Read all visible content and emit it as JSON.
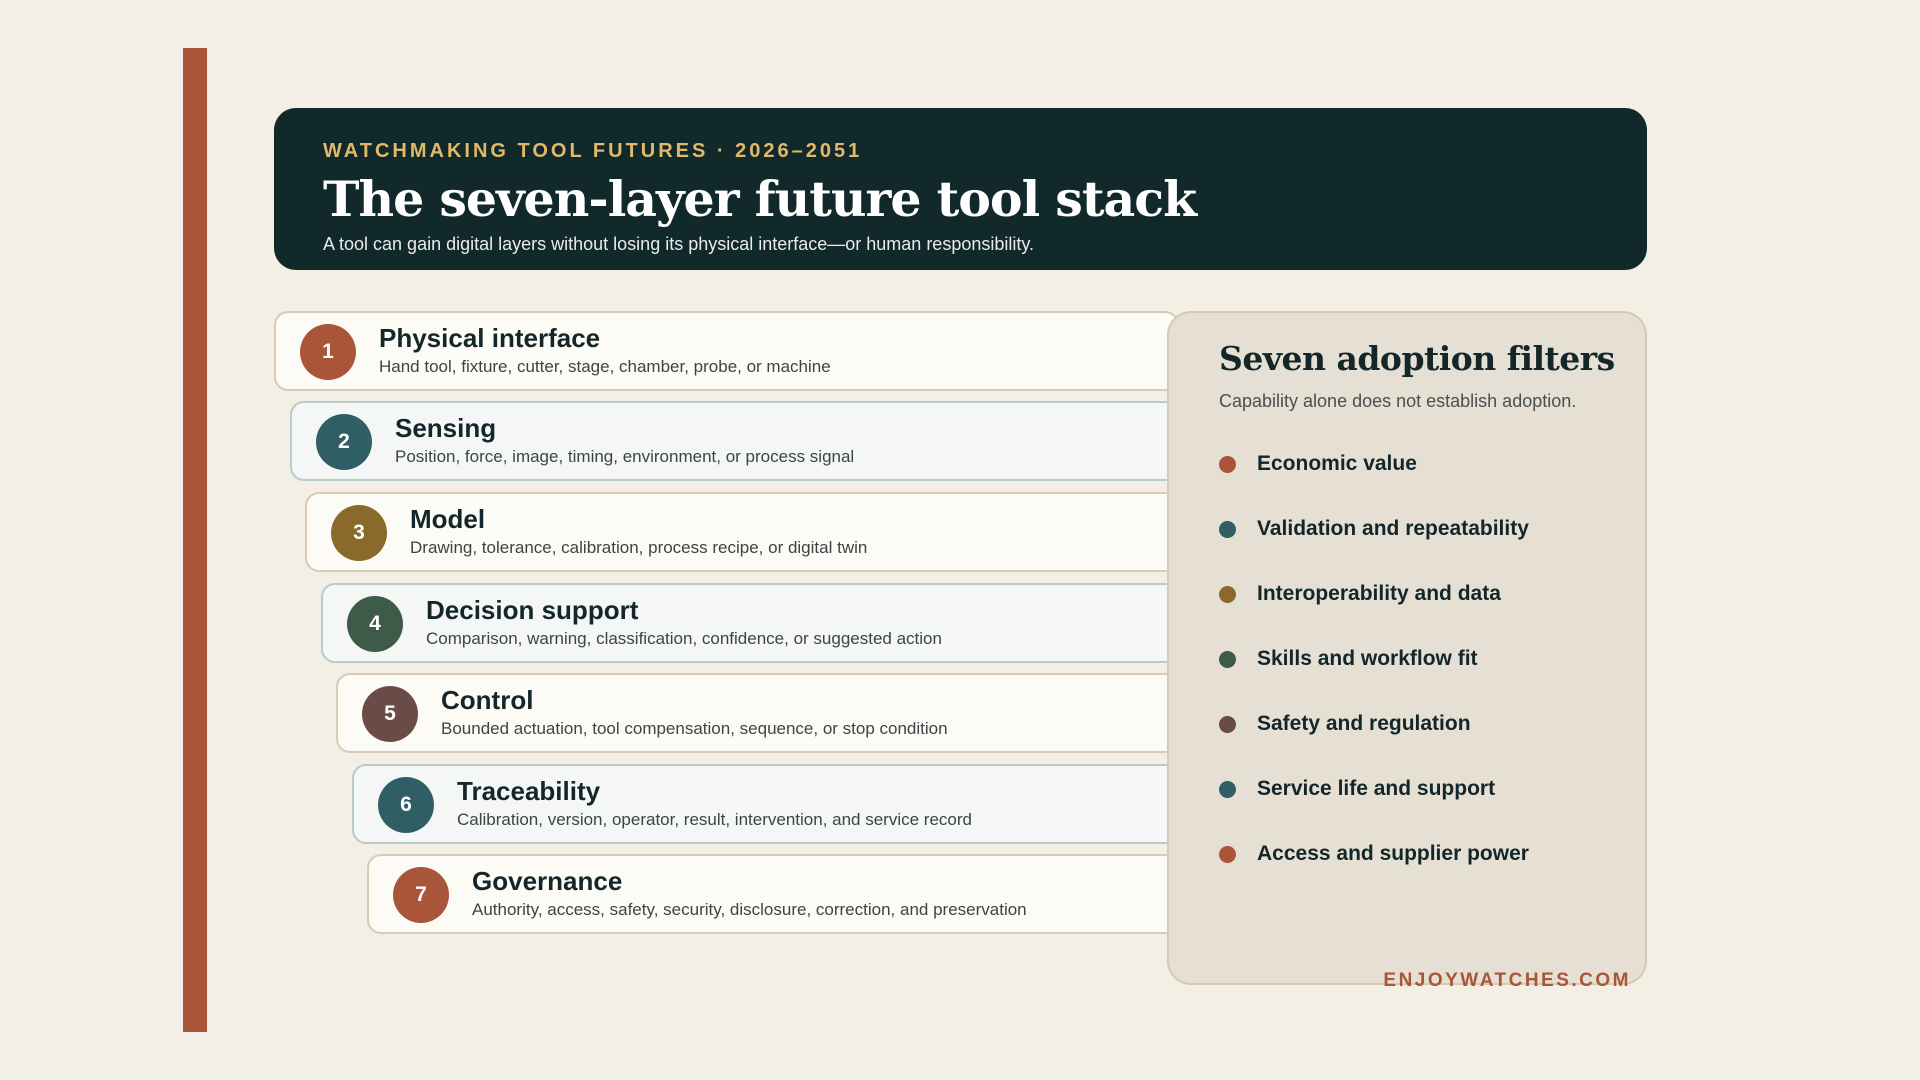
{
  "header": {
    "eyebrow": "WATCHMAKING TOOL FUTURES · 2026–2051",
    "title": "The seven-layer future tool stack",
    "subtitle": "A tool can gain digital layers without losing its physical interface—or human responsibility."
  },
  "layers": [
    {
      "number": "1",
      "name": "Physical interface",
      "description": "Hand tool, fixture, cutter, stage, chamber, probe, or machine",
      "color": "#a9553a"
    },
    {
      "number": "2",
      "name": "Sensing",
      "description": "Position, force, image, timing, environment, or process signal",
      "color": "#2f5f64"
    },
    {
      "number": "3",
      "name": "Model",
      "description": "Drawing, tolerance, calibration, process recipe, or digital twin",
      "color": "#8a6a2c"
    },
    {
      "number": "4",
      "name": "Decision support",
      "description": "Comparison, warning, classification, confidence, or suggested action",
      "color": "#3e5a48"
    },
    {
      "number": "5",
      "name": "Control",
      "description": "Bounded actuation, tool compensation, sequence, or stop condition",
      "color": "#6b4b47"
    },
    {
      "number": "6",
      "name": "Traceability",
      "description": "Calibration, version, operator, result, intervention, and service record",
      "color": "#2f5f64"
    },
    {
      "number": "7",
      "name": "Governance",
      "description": "Authority, access, safety, security, disclosure, correction, and preservation",
      "color": "#a9553a"
    }
  ],
  "filters": {
    "title": "Seven adoption filters",
    "subtitle": "Capability alone does not establish adoption.",
    "items": [
      {
        "label": "Economic value",
        "color": "#a9553a"
      },
      {
        "label": "Validation and repeatability",
        "color": "#2f5f64"
      },
      {
        "label": "Interoperability and data",
        "color": "#8a6a2c"
      },
      {
        "label": "Skills and workflow fit",
        "color": "#3e5a48"
      },
      {
        "label": "Safety and regulation",
        "color": "#6b4b47"
      },
      {
        "label": "Service life and support",
        "color": "#2f5f64"
      },
      {
        "label": "Access and supplier power",
        "color": "#a9553a"
      }
    ]
  },
  "footer": {
    "brand": "ENJOYWATCHES.COM"
  }
}
